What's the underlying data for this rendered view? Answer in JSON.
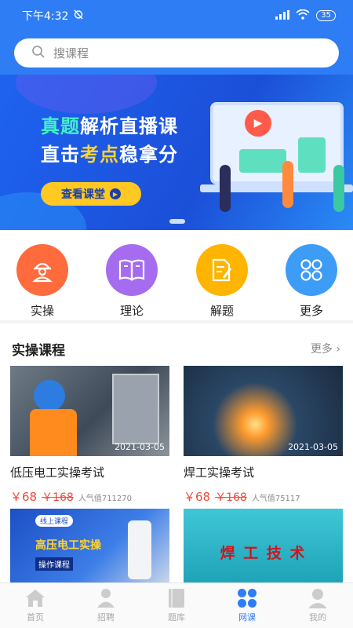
{
  "status_bar": {
    "time": "下午4:32",
    "signal": "|||",
    "battery": "35"
  },
  "search": {
    "placeholder": "搜课程"
  },
  "banner": {
    "line1_part1": "真题",
    "line1_part2": "解析直播课",
    "line2_part1": "直击",
    "line2_part2": "考点",
    "line2_part3": "稳拿分",
    "button_label": "查看课堂"
  },
  "categories": [
    {
      "label": "实操",
      "icon": "worker-icon",
      "color": "#ff6b3d"
    },
    {
      "label": "理论",
      "icon": "book-icon",
      "color": "#a66cf0"
    },
    {
      "label": "解题",
      "icon": "document-edit-icon",
      "color": "#ffb400"
    },
    {
      "label": "更多",
      "icon": "grid-icon",
      "color": "#3d9cf5"
    }
  ],
  "section": {
    "title": "实操课程",
    "more_label": "更多",
    "courses": [
      {
        "title": "低压电工实操考试",
        "date": "2021-03-05",
        "price": "￥68",
        "old_price": "￥168",
        "popularity": "人气值711270"
      },
      {
        "title": "焊工实操考试",
        "date": "2021-03-05",
        "price": "￥68",
        "old_price": "￥168",
        "popularity": "人气值75117"
      },
      {
        "tag": "线上课程",
        "overlay_title": "高压电工实操",
        "overlay_sub": "操作课程"
      },
      {
        "overlay_title": "焊 工 技 术"
      }
    ]
  },
  "nav": {
    "items": [
      {
        "label": "首页",
        "icon": "home-icon"
      },
      {
        "label": "招聘",
        "icon": "person-icon"
      },
      {
        "label": "题库",
        "icon": "book-icon"
      },
      {
        "label": "网课",
        "icon": "grid-icon",
        "active": true
      },
      {
        "label": "我的",
        "icon": "user-icon"
      }
    ]
  },
  "colors": {
    "primary": "#2f7df5",
    "price": "#f04a3a",
    "banner_button": "#ffc822"
  }
}
